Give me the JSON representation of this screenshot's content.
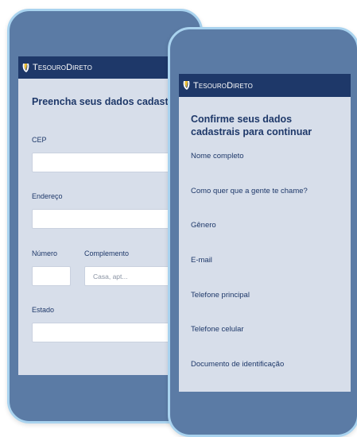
{
  "brand": {
    "name": "TesouroDireto"
  },
  "back_form": {
    "title": "Preencha seus dados cadastrais",
    "cep_label": "CEP",
    "endereco_label": "Endereço",
    "numero_label": "Número",
    "complemento_label": "Complemento",
    "complemento_placeholder": "Casa, apt...",
    "estado_label": "Estado"
  },
  "front_form": {
    "title": "Confirme seus dados cadastrais para continuar",
    "fields": [
      "Nome completo",
      "Como quer que a gente te chame?",
      "Gênero",
      "E-mail",
      "Telefone principal",
      "Telefone celular",
      "Documento de identificação"
    ]
  },
  "colors": {
    "navy": "#1e3869",
    "phone_body": "#5b7ba5",
    "phone_rim": "#a9d3ef",
    "screen": "#d7deea",
    "logo_accent": "#f2c230"
  }
}
